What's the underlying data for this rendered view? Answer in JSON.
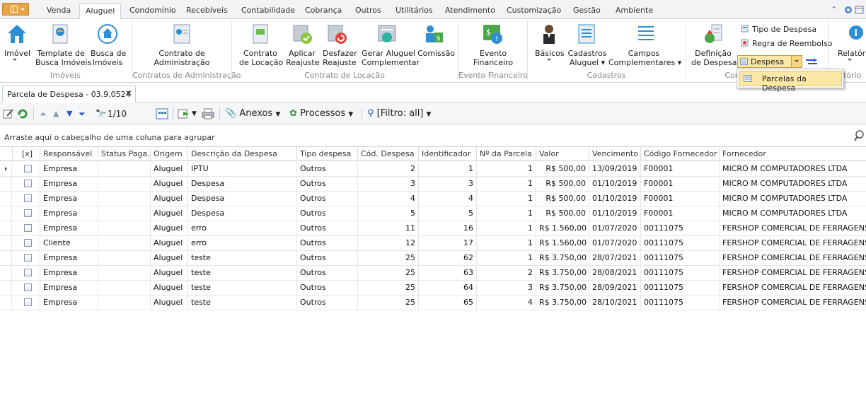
{
  "menu": {
    "tabs": [
      "Venda",
      "Aluguel",
      "Condomínio",
      "Recebíveis",
      "Contabilidade",
      "Cobrança",
      "Outros",
      "Utilitários",
      "Atendimento",
      "Customização",
      "Gestão",
      "Ambiente"
    ],
    "active_tab": "Aluguel"
  },
  "ribbon": {
    "groups": {
      "imoveis": "Imóveis",
      "contratos_adm": "Contratos de Administração",
      "contrato_locacao": "Contrato de Locação",
      "evento_financeiro": "Evento Financeiro",
      "cadastros": "Cadastros",
      "con_truncated": "Con",
      "relatorios_truncated": "tório"
    },
    "buttons": {
      "imovel": "Imóvel",
      "template_l1": "Template de",
      "template_l2": "Busca Imóveis",
      "busca_l1": "Busca de",
      "busca_l2": "Imóveis",
      "contrato_adm_l1": "Contrato de",
      "contrato_adm_l2": "Administração",
      "contrato_loc_l1": "Contrato",
      "contrato_loc_l2": "de Locação",
      "aplicar_l1": "Aplicar",
      "aplicar_l2": "Reajuste",
      "desfazer_l1": "Desfazer",
      "desfazer_l2": "Reajuste",
      "gerar_l1": "Gerar Aluguel",
      "gerar_l2": "Complementar",
      "comissao": "Comissão",
      "evento_l1": "Evento",
      "evento_l2": "Financeiro",
      "basicos": "Básicos",
      "cadastros_l1": "Cadastros",
      "cadastros_l2": "Aluguel ▾",
      "campos_l1": "Campos",
      "campos_l2": "Complementares ▾",
      "definicao_l1": "Definição",
      "definicao_l2": "de Despesa",
      "tipo_despesa": "Tipo de Despesa",
      "regra_reembolso": "Regra de Reembolso",
      "despesa": "Despesa",
      "relatorios": "Relatóri"
    }
  },
  "dropdown": {
    "item": "Parcelas da Despesa"
  },
  "doc_tab": {
    "title": "Parcela de Despesa - 03.9.0524"
  },
  "toolbar": {
    "record_counter": "1/10",
    "anexos": "Anexos",
    "processos": "Processos",
    "filtro": "[Filtro: all]"
  },
  "group_panel": {
    "text": "Arraste aqui o cabeçalho de uma coluna para agrupar"
  },
  "grid": {
    "columns": [
      "[x]",
      "Responsável",
      "Status Paga...",
      "Origem",
      "Descrição da Despesa",
      "Tipo despesa",
      "Cód. Despesa",
      "Identificador",
      "Nº da Parcela",
      "Valor",
      "Vencimento",
      "Código Fornecedor",
      "Fornecedor"
    ],
    "rows": [
      {
        "responsavel": "Empresa",
        "status": "",
        "origem": "Aluguel",
        "descricao": "IPTU",
        "tipo": "Outros",
        "cod": "2",
        "ident": "1",
        "parcela": "1",
        "valor": "R$ 500,00",
        "vencimento": "13/09/2019",
        "cod_forn": "F00001",
        "fornecedor": "MICRO M COMPUTADORES LTDA"
      },
      {
        "responsavel": "Empresa",
        "status": "",
        "origem": "Aluguel",
        "descricao": "Despesa",
        "tipo": "Outros",
        "cod": "3",
        "ident": "3",
        "parcela": "1",
        "valor": "R$ 500,00",
        "vencimento": "01/10/2019",
        "cod_forn": "F00001",
        "fornecedor": "MICRO M COMPUTADORES LTDA"
      },
      {
        "responsavel": "Empresa",
        "status": "",
        "origem": "Aluguel",
        "descricao": "Despesa",
        "tipo": "Outros",
        "cod": "4",
        "ident": "4",
        "parcela": "1",
        "valor": "R$ 500,00",
        "vencimento": "01/10/2019",
        "cod_forn": "F00001",
        "fornecedor": "MICRO M COMPUTADORES LTDA"
      },
      {
        "responsavel": "Empresa",
        "status": "",
        "origem": "Aluguel",
        "descricao": "Despesa",
        "tipo": "Outros",
        "cod": "5",
        "ident": "5",
        "parcela": "1",
        "valor": "R$ 500,00",
        "vencimento": "01/10/2019",
        "cod_forn": "F00001",
        "fornecedor": "MICRO M COMPUTADORES LTDA"
      },
      {
        "responsavel": "Empresa",
        "status": "",
        "origem": "Aluguel",
        "descricao": "erro",
        "tipo": "Outros",
        "cod": "11",
        "ident": "16",
        "parcela": "1",
        "valor": "R$ 1.560,00",
        "vencimento": "01/07/2020",
        "cod_forn": "00111075",
        "fornecedor": "FERSHOP COMERCIAL DE FERRAGENS LTDA"
      },
      {
        "responsavel": "Cliente",
        "status": "",
        "origem": "Aluguel",
        "descricao": "erro",
        "tipo": "Outros",
        "cod": "12",
        "ident": "17",
        "parcela": "1",
        "valor": "R$ 1.560,00",
        "vencimento": "01/07/2020",
        "cod_forn": "00111075",
        "fornecedor": "FERSHOP COMERCIAL DE FERRAGENS LTDA"
      },
      {
        "responsavel": "Empresa",
        "status": "",
        "origem": "Aluguel",
        "descricao": "teste",
        "tipo": "Outros",
        "cod": "25",
        "ident": "62",
        "parcela": "1",
        "valor": "R$ 3.750,00",
        "vencimento": "28/07/2021",
        "cod_forn": "00111075",
        "fornecedor": "FERSHOP COMERCIAL DE FERRAGENS LTDA"
      },
      {
        "responsavel": "Empresa",
        "status": "",
        "origem": "Aluguel",
        "descricao": "teste",
        "tipo": "Outros",
        "cod": "25",
        "ident": "63",
        "parcela": "2",
        "valor": "R$ 3.750,00",
        "vencimento": "28/08/2021",
        "cod_forn": "00111075",
        "fornecedor": "FERSHOP COMERCIAL DE FERRAGENS LTDA"
      },
      {
        "responsavel": "Empresa",
        "status": "",
        "origem": "Aluguel",
        "descricao": "teste",
        "tipo": "Outros",
        "cod": "25",
        "ident": "64",
        "parcela": "3",
        "valor": "R$ 3.750,00",
        "vencimento": "28/09/2021",
        "cod_forn": "00111075",
        "fornecedor": "FERSHOP COMERCIAL DE FERRAGENS LTDA"
      },
      {
        "responsavel": "Empresa",
        "status": "",
        "origem": "Aluguel",
        "descricao": "teste",
        "tipo": "Outros",
        "cod": "25",
        "ident": "65",
        "parcela": "4",
        "valor": "R$ 3.750,00",
        "vencimento": "28/10/2021",
        "cod_forn": "00111075",
        "fornecedor": "FERSHOP COMERCIAL DE FERRAGENS LTDA"
      }
    ]
  },
  "colors": {
    "accent_orange": "#e3a548",
    "hover_yellow": "#fde7a6",
    "border": "#c8cfd9"
  }
}
